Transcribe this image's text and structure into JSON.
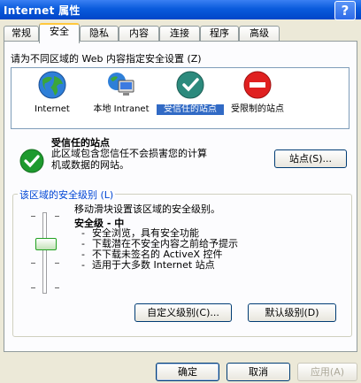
{
  "window": {
    "title": "Internet 属性",
    "help_glyph": "?"
  },
  "tabs": [
    {
      "label": "常规"
    },
    {
      "label": "安全"
    },
    {
      "label": "隐私"
    },
    {
      "label": "内容"
    },
    {
      "label": "连接"
    },
    {
      "label": "程序"
    },
    {
      "label": "高级"
    }
  ],
  "active_tab": "安全",
  "security": {
    "zone_prompt": "请为不同区域的 Web 内容指定安全设置 (Z)",
    "zones": [
      {
        "label": "Internet",
        "icon": "globe-icon"
      },
      {
        "label": "本地 Intranet",
        "icon": "intranet-icon"
      },
      {
        "label": "受信任的站点",
        "icon": "trusted-check-icon"
      },
      {
        "label": "受限制的站点",
        "icon": "restricted-icon"
      }
    ],
    "selected_zone": "受信任的站点",
    "site_title": "受信任的站点",
    "site_desc": "此区域包含您信任不会损害您的计算机或数据的网站。",
    "sites_button": "站点(S)...",
    "group_label": "该区域的安全级别 (L)",
    "slider_hint": "移动滑块设置该区域的安全级别。",
    "level_name": "安全级 - 中",
    "bullets": [
      "安全浏览，具有安全功能",
      "下载潜在不安全内容之前给予提示",
      "不下载未签名的 ActiveX 控件",
      "适用于大多数 Internet 站点"
    ],
    "custom_level_button": "自定义级别(C)...",
    "default_level_button": "默认级别(D)"
  },
  "footer": {
    "ok": "确定",
    "cancel": "取消",
    "apply": "应用(A)"
  },
  "colors": {
    "titlebar": "#0A5BDC",
    "selection": "#316AC5",
    "tab_highlight": "#FFC83C"
  }
}
